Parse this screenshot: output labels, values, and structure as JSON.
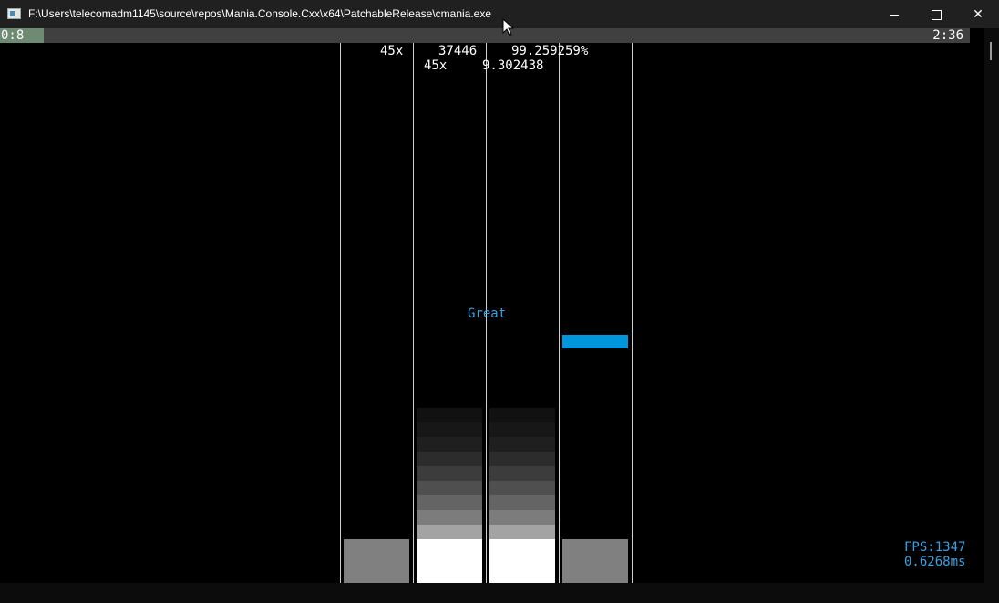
{
  "window": {
    "title": "F:\\Users\\telecomadm1145\\source\\repos\\Mania.Console.Cxx\\x64\\PatchableRelease\\cmania.exe"
  },
  "progress": {
    "elapsed": "0:8",
    "total": "2:36",
    "fraction": 0.045
  },
  "hud": {
    "combo": "45x",
    "score": "37446",
    "accuracy": "99.259259%",
    "combo_secondary": "45x",
    "value_secondary": "9.302438"
  },
  "judgement": "Great",
  "stats": {
    "fps": "FPS:1347",
    "frame_time": "0.6268ms"
  },
  "colors": {
    "accent": "#0096dc",
    "judge_text": "#3aa0e0",
    "progress_fill": "#6f8a72",
    "key_idle": "#808080",
    "key_pressed": "#ffffff"
  },
  "keys": [
    {
      "lane": 1,
      "pressed": false
    },
    {
      "lane": 2,
      "pressed": true
    },
    {
      "lane": 3,
      "pressed": true
    },
    {
      "lane": 4,
      "pressed": false
    }
  ]
}
